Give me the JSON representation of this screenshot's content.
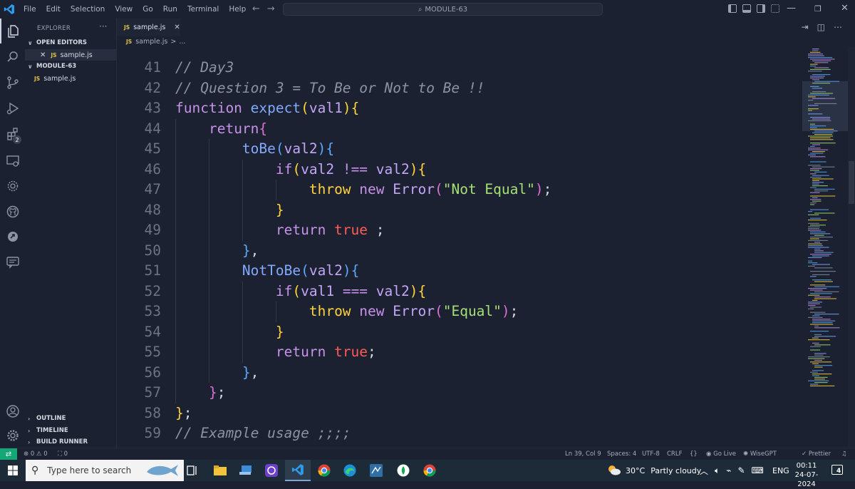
{
  "titlebar": {
    "menu": [
      "File",
      "Edit",
      "Selection",
      "View",
      "Go",
      "Run",
      "Terminal",
      "Help"
    ],
    "command_center": "MODULE-63",
    "icons": [
      "vscode-logo-icon",
      "back-arrow-icon",
      "forward-arrow-icon",
      "search-icon",
      "toggle-primary-sidebar-icon",
      "toggle-panel-icon",
      "toggle-secondary-sidebar-icon",
      "customize-layout-icon",
      "minimize-icon",
      "restore-icon",
      "close-icon"
    ]
  },
  "activitybar": {
    "icons": [
      "explorer-icon",
      "search-icon",
      "source-control-icon",
      "run-debug-icon",
      "extensions-icon",
      "remote-explorer-icon",
      "testing-icon",
      "github-icon",
      "live-share-icon",
      "chat-icon",
      "accounts-icon",
      "settings-gear-icon"
    ],
    "extensions_badge": "2"
  },
  "sidebar": {
    "title": "EXPLORER",
    "more": "···",
    "open_editors_label": "OPEN EDITORS",
    "open_editor_file": "sample.js",
    "folder_label": "MODULE-63",
    "folder_file": "sample.js",
    "js_tag": "JS",
    "outline": "OUTLINE",
    "timeline": "TIMELINE",
    "build_runner": "BUILD RUNNER"
  },
  "tabs": [
    {
      "label": "sample.js",
      "icon": "JS",
      "close": "✕",
      "active": true
    }
  ],
  "breadcrumb": {
    "tag": "JS",
    "file": "sample.js",
    "sep": ">",
    "rest": "..."
  },
  "editor": {
    "colors": {
      "comment": "#8b93a3",
      "keyword": "#c792ea",
      "function": "#82aaff",
      "param": "#c3a6f5",
      "bracket1": "#ffd43b",
      "bracket2": "#da70d6",
      "bracket3": "#5aa9ff",
      "string": "#a5e075",
      "boolean": "#ff5c57",
      "class": "#c3a6f5",
      "throw": "#ffd33d",
      "plain": "#d6d9e0"
    },
    "lines": [
      {
        "n": "41",
        "tokens": [
          [
            "comment",
            "// Day3"
          ]
        ]
      },
      {
        "n": "42",
        "tokens": [
          [
            "comment",
            "// Question 3 = To Be or Not to Be !!"
          ]
        ]
      },
      {
        "n": "43",
        "tokens": [
          [
            "kw",
            "function "
          ],
          [
            "fn",
            "expect"
          ],
          [
            "b1",
            "("
          ],
          [
            "pm",
            "val1"
          ],
          [
            "b1",
            ")"
          ],
          [
            "b1",
            "{"
          ]
        ]
      },
      {
        "n": "44",
        "tokens": [
          [
            "ws",
            "    "
          ],
          [
            "kw",
            "return"
          ],
          [
            "b2",
            "{"
          ]
        ]
      },
      {
        "n": "45",
        "tokens": [
          [
            "ws",
            "        "
          ],
          [
            "fn",
            "toBe"
          ],
          [
            "b3",
            "("
          ],
          [
            "pm",
            "val2"
          ],
          [
            "b3",
            ")"
          ],
          [
            "b3",
            "{"
          ]
        ]
      },
      {
        "n": "46",
        "tokens": [
          [
            "ws",
            "            "
          ],
          [
            "kw",
            "if"
          ],
          [
            "b1",
            "("
          ],
          [
            "pm",
            "val2 "
          ],
          [
            "kw",
            "!== "
          ],
          [
            "pm",
            "val2"
          ],
          [
            "b1",
            ")"
          ],
          [
            "b1",
            "{"
          ]
        ]
      },
      {
        "n": "47",
        "tokens": [
          [
            "ws",
            "                "
          ],
          [
            "th",
            "throw "
          ],
          [
            "kw",
            "new "
          ],
          [
            "cls",
            "Error"
          ],
          [
            "b2",
            "("
          ],
          [
            "str",
            "\"Not Equal\""
          ],
          [
            "b2",
            ")"
          ],
          [
            "plain",
            ";"
          ]
        ]
      },
      {
        "n": "48",
        "tokens": [
          [
            "ws",
            "            "
          ],
          [
            "b1",
            "}"
          ]
        ]
      },
      {
        "n": "49",
        "tokens": [
          [
            "ws",
            "            "
          ],
          [
            "kw",
            "return "
          ],
          [
            "bool",
            "true"
          ],
          [
            "plain",
            " ;"
          ]
        ]
      },
      {
        "n": "50",
        "tokens": [
          [
            "ws",
            "        "
          ],
          [
            "b3",
            "}"
          ],
          [
            "plain",
            ","
          ]
        ]
      },
      {
        "n": "51",
        "tokens": [
          [
            "ws",
            "        "
          ],
          [
            "fn",
            "NotToBe"
          ],
          [
            "b3",
            "("
          ],
          [
            "pm",
            "val2"
          ],
          [
            "b3",
            ")"
          ],
          [
            "b3",
            "{"
          ]
        ]
      },
      {
        "n": "52",
        "tokens": [
          [
            "ws",
            "            "
          ],
          [
            "kw",
            "if"
          ],
          [
            "b1",
            "("
          ],
          [
            "pm",
            "val1 "
          ],
          [
            "kw",
            "=== "
          ],
          [
            "pm",
            "val2"
          ],
          [
            "b1",
            ")"
          ],
          [
            "b1",
            "{"
          ]
        ]
      },
      {
        "n": "53",
        "tokens": [
          [
            "ws",
            "                "
          ],
          [
            "th",
            "throw "
          ],
          [
            "kw",
            "new "
          ],
          [
            "cls",
            "Error"
          ],
          [
            "b2",
            "("
          ],
          [
            "str",
            "\"Equal\""
          ],
          [
            "b2",
            ")"
          ],
          [
            "plain",
            ";"
          ]
        ]
      },
      {
        "n": "54",
        "tokens": [
          [
            "ws",
            "            "
          ],
          [
            "b1",
            "}"
          ]
        ]
      },
      {
        "n": "55",
        "tokens": [
          [
            "ws",
            "            "
          ],
          [
            "kw",
            "return "
          ],
          [
            "bool",
            "true"
          ],
          [
            "plain",
            ";"
          ]
        ]
      },
      {
        "n": "56",
        "tokens": [
          [
            "ws",
            "        "
          ],
          [
            "b3",
            "}"
          ],
          [
            "plain",
            ","
          ]
        ]
      },
      {
        "n": "57",
        "tokens": [
          [
            "ws",
            "    "
          ],
          [
            "b2",
            "}"
          ],
          [
            "plain",
            ";"
          ]
        ]
      },
      {
        "n": "58",
        "tokens": [
          [
            "b1",
            "}"
          ],
          [
            "plain",
            ";"
          ]
        ]
      },
      {
        "n": "59",
        "tokens": [
          [
            "comment",
            "// Example usage ;;;;"
          ]
        ]
      }
    ]
  },
  "statusbar": {
    "remote_icon": "remote-icon",
    "problems": "⊗ 0 ⚠ 0",
    "ports": "⛶ 0",
    "position": "Ln 39, Col 9",
    "spaces": "Spaces: 4",
    "encoding": "UTF-8",
    "eol": "CRLF",
    "braces": "{}",
    "golive": "Go Live",
    "wisegpt": "WiseGPT",
    "prettier": "Prettier",
    "notifications_icon": "bell-icon",
    "accent": "#13a875"
  },
  "taskbar": {
    "search_placeholder": "Type here to search",
    "apps": [
      "task-view-icon",
      "file-explorer-icon",
      "app-icon",
      "github-desktop-icon",
      "vscode-icon",
      "chrome-icon",
      "edge-icon",
      "app-icon",
      "app-icon",
      "chrome-icon"
    ],
    "weather": "30°C",
    "weather_desc": "Partly cloudy",
    "lang": "ENG",
    "time": "00:11",
    "date": "24-07-2024",
    "notification_count": "4"
  }
}
